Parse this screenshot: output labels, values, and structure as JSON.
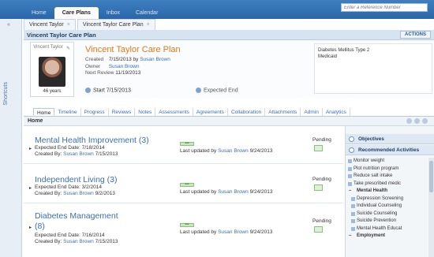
{
  "top_tabs": [
    "Home",
    "Care Plans",
    "Inbox",
    "Calendar"
  ],
  "reference_placeholder": "Enter a Reference Number",
  "rail_label": "Shortcuts",
  "person_tabs": [
    "Vincent Taylor",
    "Vincent Taylor Care Plan"
  ],
  "plan_header": {
    "title": "Vincent Taylor Care Plan",
    "actions_label": "ACTIONS"
  },
  "summary": {
    "photo_name": "Vincent Taylor",
    "age": "46 years",
    "plan_title": "Vincent Taylor Care Plan",
    "created_label": "Created",
    "created_value": "7/15/2013 by",
    "created_by": "Susan Brown",
    "owner_label": "Owner",
    "owner_value": "Susan Brown",
    "next_review_label": "Next Review",
    "next_review_value": "11/19/2013",
    "start_label": "Start",
    "start_date": "7/15/2013",
    "end_label": "Expected End",
    "diagnoses": [
      "Diabetes Mellitus Type 2",
      "Medicaid"
    ]
  },
  "section_tabs": [
    "Home",
    "Timeline",
    "Progress",
    "Reviews",
    "Notes",
    "Assessments",
    "Agreements",
    "Collaboration",
    "Attachments",
    "Admin",
    "Analytics"
  ],
  "home_label": "Home",
  "goals": [
    {
      "title": "Mental Health Improvement (3)",
      "end_label": "Expected End Date:",
      "end_date": "7/18/2014",
      "created_label": "Created By:",
      "created_by": "Susan Brown",
      "created_date": "7/15/2013",
      "updated_label": "Last updated by",
      "updated_by": "Susan Brown",
      "updated_date": "9/24/2013",
      "status": "Pending"
    },
    {
      "title": "Independent Living (3)",
      "end_label": "Expected End Date:",
      "end_date": "3/2/2014",
      "created_label": "Created By:",
      "created_by": "Susan Brown",
      "created_date": "9/2/2013",
      "updated_label": "Last updated by",
      "updated_by": "Susan Brown",
      "updated_date": "9/24/2013",
      "status": "Pending"
    },
    {
      "title": "Diabetes Management",
      "title_count": "(8)",
      "end_label": "Expected End Date:",
      "end_date": "7/16/2014",
      "created_label": "Created By:",
      "created_by": "Susan Brown",
      "created_date": "7/15/2013",
      "updated_label": "Last updated by",
      "updated_by": "Susan Brown",
      "updated_date": "9/24/2013",
      "status": "Pending"
    }
  ],
  "right_panel": {
    "objectives_label": "Objectives",
    "activities_label": "Recommended Activities",
    "items": [
      {
        "type": "item",
        "label": "Monitor weight"
      },
      {
        "type": "item",
        "label": "Plot nutrition program"
      },
      {
        "type": "item",
        "label": "Reduce salt intake"
      },
      {
        "type": "item",
        "label": "Take prescribed medic"
      },
      {
        "type": "cat",
        "label": "Mental Health"
      },
      {
        "type": "sub",
        "label": "Depression Screening"
      },
      {
        "type": "sub",
        "label": "Individual Counseling"
      },
      {
        "type": "sub",
        "label": "Suicide Counseling"
      },
      {
        "type": "sub",
        "label": "Suicide Prevention"
      },
      {
        "type": "sub",
        "label": "Mental Health Educat"
      },
      {
        "type": "cat",
        "label": "Employment"
      }
    ]
  }
}
